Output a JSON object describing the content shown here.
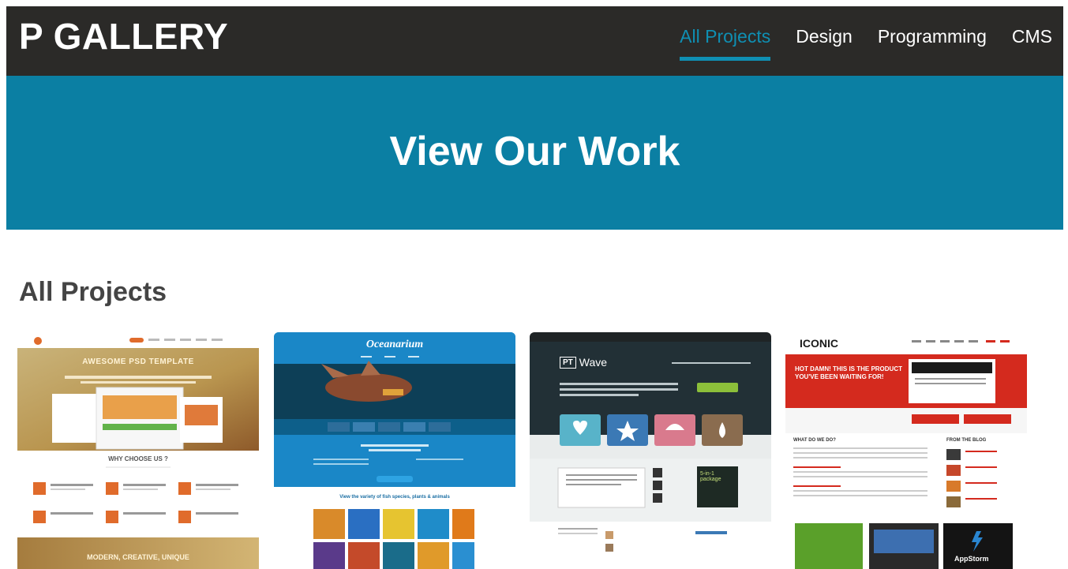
{
  "brand": "P GALLERY",
  "nav": {
    "items": [
      "All Projects",
      "Design",
      "Programming",
      "CMS"
    ],
    "active": "All Projects"
  },
  "hero": {
    "title": "View Our Work"
  },
  "section": {
    "title": "All Projects"
  },
  "thumbnails": [
    {
      "heading": "AWESOME PSD TEMPLATE",
      "subheading": "WHY CHOOSE US ?",
      "footer": "MODERN, CREATIVE, UNIQUE"
    },
    {
      "heading": "Oceanarium",
      "subheading": "View the variety of fish species, plants & animals"
    },
    {
      "heading": "Wave",
      "logo": "PT",
      "badge": "5-in-1 package"
    },
    {
      "heading": "ICONIC",
      "banner": "HOT DAMN! THIS IS THE PRODUCT YOU'VE BEEN WAITING FOR!",
      "blog": "FROM THE BLOG",
      "services": "WHAT DO WE DO?",
      "app": "AppStorm"
    }
  ],
  "colors": {
    "navbar": "#2b2a28",
    "hero": "#0b7fa3",
    "accent": "#0f8fb3"
  }
}
